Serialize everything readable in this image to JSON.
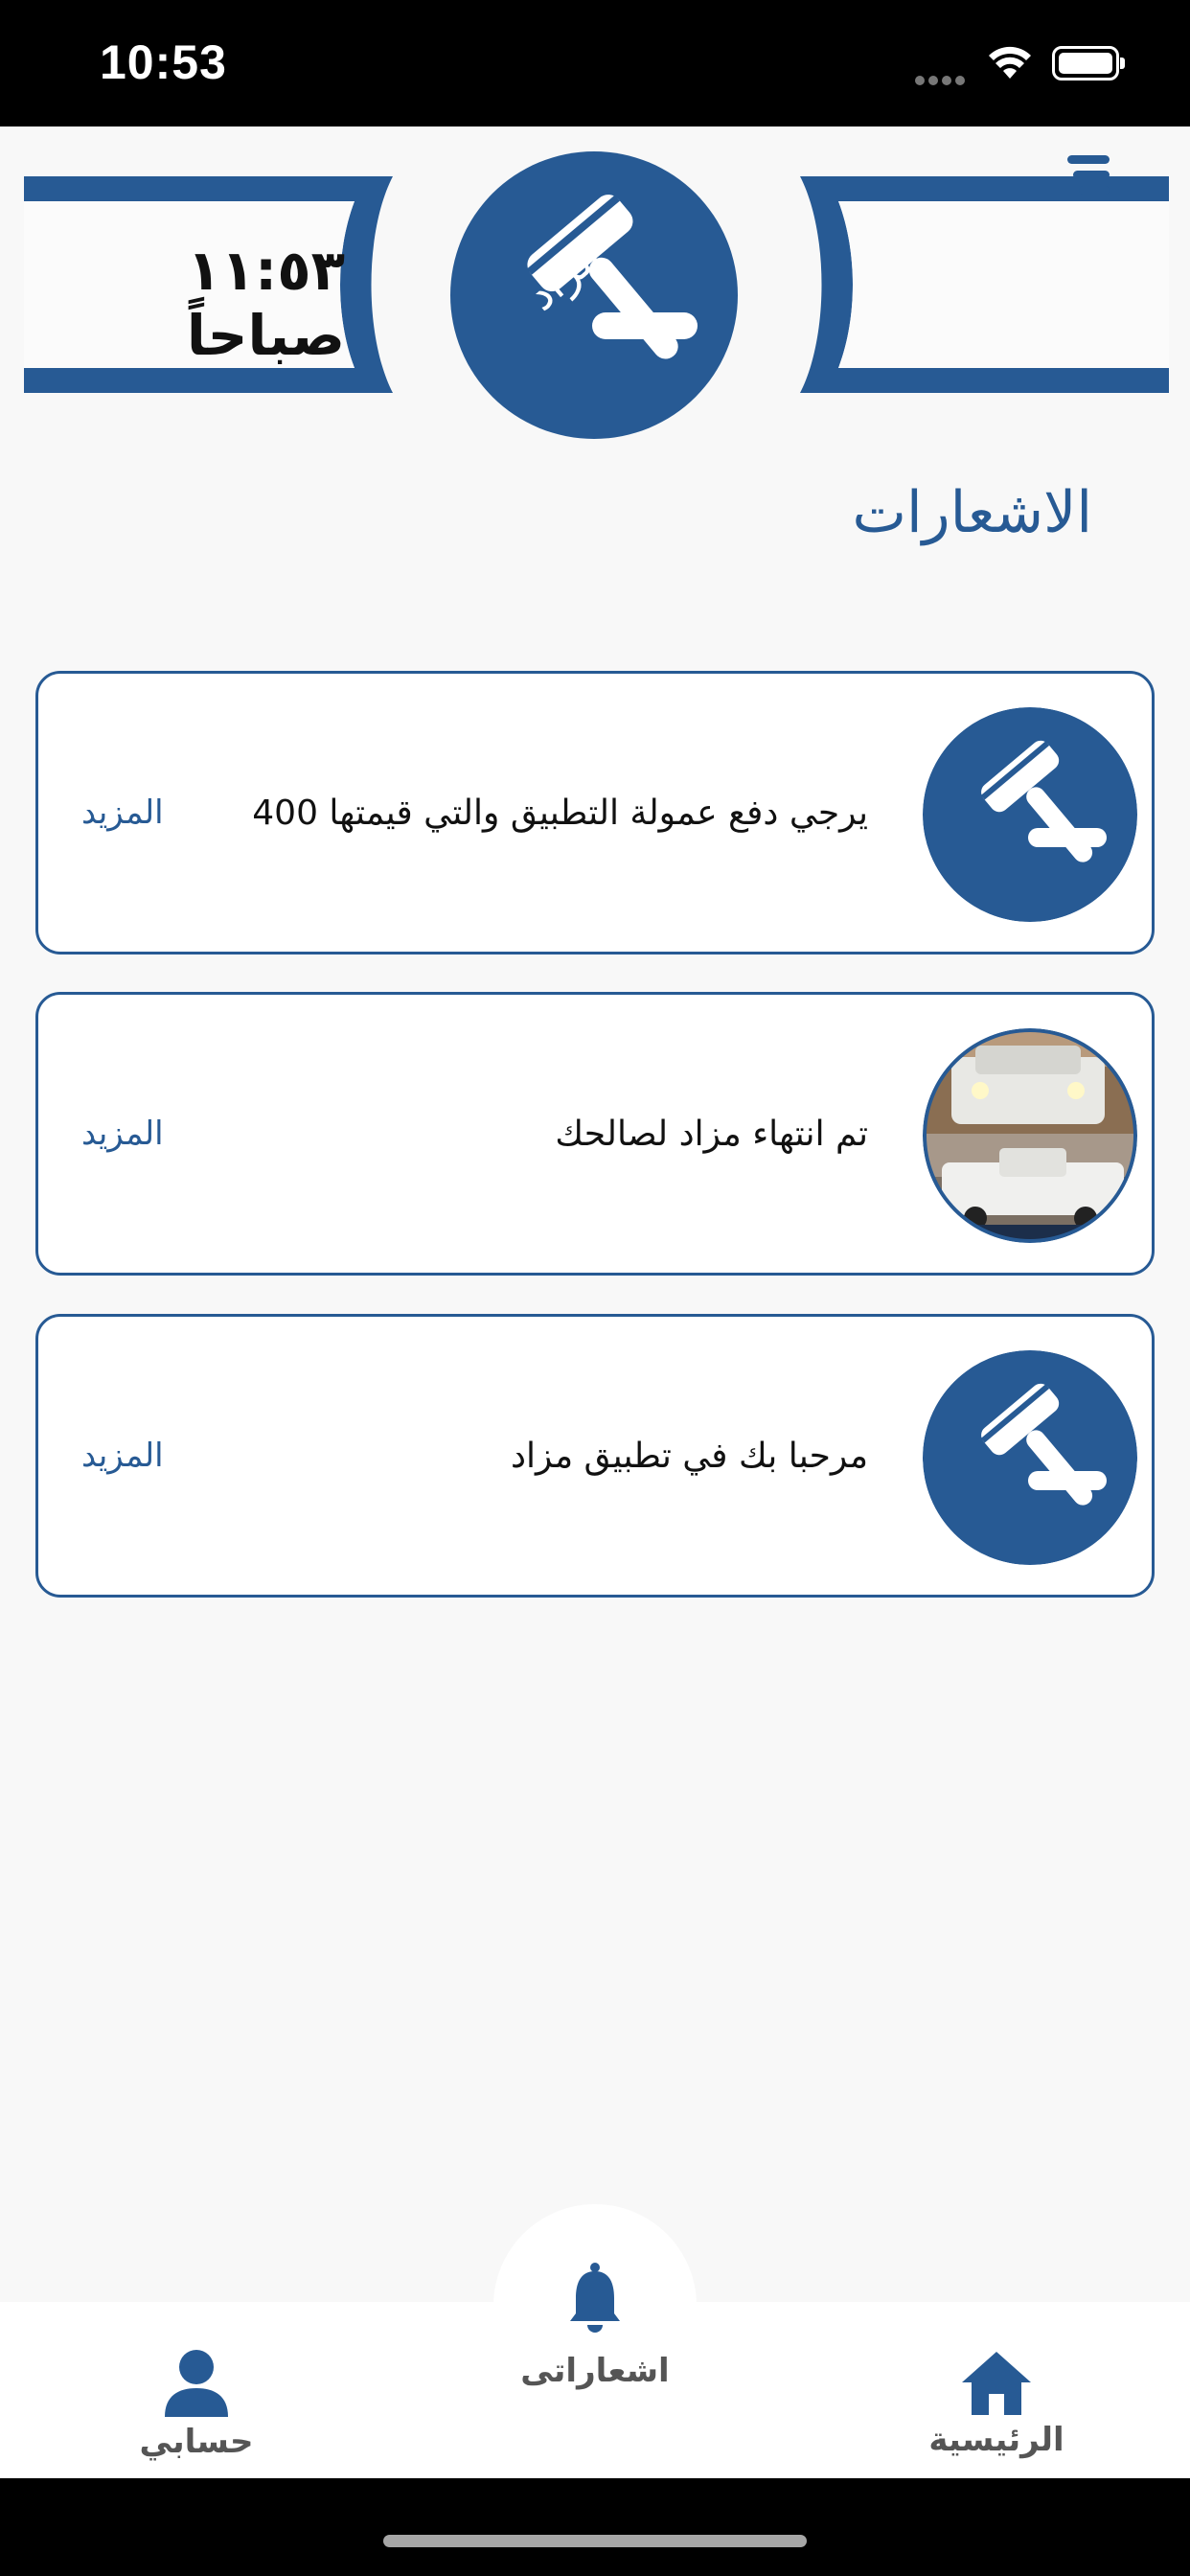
{
  "status_bar": {
    "time": "10:53"
  },
  "header": {
    "clock": "١١:٥٣ صباحاً",
    "logo_text": "مزاد",
    "menu_icon": "menu-icon"
  },
  "page": {
    "title": "الاشعارات"
  },
  "notifications": [
    {
      "message": "يرجي دفع عمولة التطبيق والتي قيمتها 400",
      "more": "المزيد",
      "thumb": "app-logo"
    },
    {
      "message": "تم انتهاء مزاد لصالحك",
      "more": "المزيد",
      "thumb": "car-photo"
    },
    {
      "message": "مرحبا بك في تطبيق مزاد",
      "more": "المزيد",
      "thumb": "app-logo"
    }
  ],
  "tabbar": {
    "home": {
      "label": "الرئيسية",
      "icon": "home-icon"
    },
    "notifications": {
      "label": "اشعاراتى",
      "icon": "bell-icon"
    },
    "account": {
      "label": "حسابي",
      "icon": "user-icon"
    }
  },
  "colors": {
    "brand": "#275a94",
    "background": "#f8f8f8"
  }
}
